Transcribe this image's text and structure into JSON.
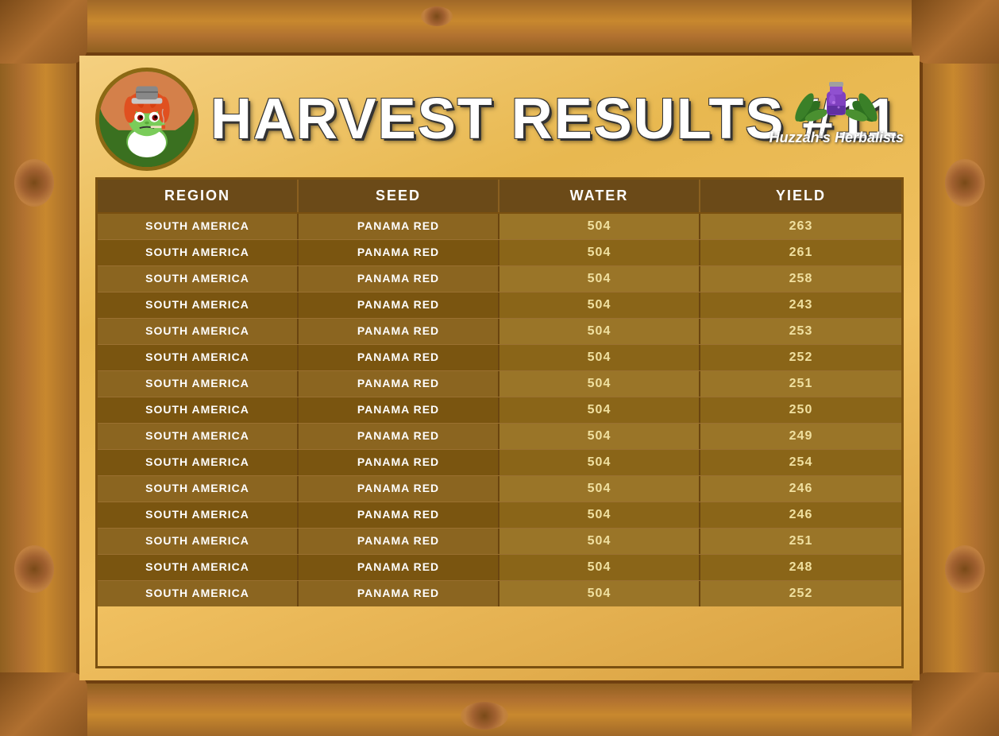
{
  "page": {
    "title": "HARVEST RESULTS #11",
    "brand": "Huzzah's Herbalists"
  },
  "table": {
    "headers": [
      "REGION",
      "SEED",
      "WATER",
      "YIELD"
    ],
    "rows": [
      {
        "region": "SOUTH AMERICA",
        "seed": "PANAMA RED",
        "water": "504",
        "yield": "263"
      },
      {
        "region": "SOUTH AMERICA",
        "seed": "PANAMA RED",
        "water": "504",
        "yield": "261"
      },
      {
        "region": "SOUTH AMERICA",
        "seed": "PANAMA RED",
        "water": "504",
        "yield": "258"
      },
      {
        "region": "SOUTH AMERICA",
        "seed": "PANAMA RED",
        "water": "504",
        "yield": "243"
      },
      {
        "region": "SOUTH AMERICA",
        "seed": "PANAMA RED",
        "water": "504",
        "yield": "253"
      },
      {
        "region": "SOUTH AMERICA",
        "seed": "PANAMA RED",
        "water": "504",
        "yield": "252"
      },
      {
        "region": "SOUTH AMERICA",
        "seed": "PANAMA RED",
        "water": "504",
        "yield": "251"
      },
      {
        "region": "SOUTH AMERICA",
        "seed": "PANAMA RED",
        "water": "504",
        "yield": "250"
      },
      {
        "region": "SOUTH AMERICA",
        "seed": "PANAMA RED",
        "water": "504",
        "yield": "249"
      },
      {
        "region": "SOUTH AMERICA",
        "seed": "PANAMA RED",
        "water": "504",
        "yield": "254"
      },
      {
        "region": "SOUTH AMERICA",
        "seed": "PANAMA RED",
        "water": "504",
        "yield": "246"
      },
      {
        "region": "SOUTH AMERICA",
        "seed": "PANAMA RED",
        "water": "504",
        "yield": "246"
      },
      {
        "region": "SOUTH AMERICA",
        "seed": "PANAMA RED",
        "water": "504",
        "yield": "251"
      },
      {
        "region": "SOUTH AMERICA",
        "seed": "PANAMA RED",
        "water": "504",
        "yield": "248"
      },
      {
        "region": "SOUTH AMERICA",
        "seed": "PANAMA RED",
        "water": "504",
        "yield": "252"
      }
    ]
  }
}
